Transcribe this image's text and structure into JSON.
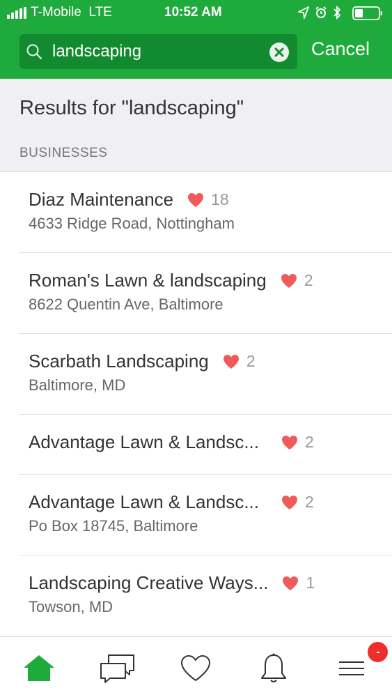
{
  "status_bar": {
    "carrier": "T-Mobile",
    "network": "LTE",
    "time": "10:52 AM"
  },
  "search": {
    "query": "landscaping",
    "cancel_label": "Cancel"
  },
  "results": {
    "title": "Results for \"landscaping\"",
    "section_label": "BUSINESSES",
    "items": [
      {
        "name": "Diaz Maintenance",
        "likes": "18",
        "address": "4633 Ridge Road, Nottingham"
      },
      {
        "name": "Roman's Lawn & landscaping",
        "likes": "2",
        "address": "8622 Quentin Ave, Baltimore"
      },
      {
        "name": "Scarbath Landscaping",
        "likes": "2",
        "address": "Baltimore, MD"
      },
      {
        "name": "Advantage Lawn & Landsc...",
        "likes": "2",
        "address": ""
      },
      {
        "name": "Advantage Lawn & Landsc...",
        "likes": "2",
        "address": "Po Box 18745, Baltimore"
      },
      {
        "name": "Landscaping Creative Ways...",
        "likes": "1",
        "address": "Towson, MD"
      }
    ]
  },
  "bottom_nav": {
    "items": [
      {
        "icon": "home-icon",
        "active": true
      },
      {
        "icon": "chat-icon",
        "active": false
      },
      {
        "icon": "heart-icon",
        "active": false
      },
      {
        "icon": "bell-icon",
        "active": false
      },
      {
        "icon": "menu-icon",
        "active": false,
        "has_badge": true
      }
    ]
  },
  "colors": {
    "brand_green": "#1faa3c",
    "search_field_green": "#128a2f",
    "heart_red": "#f05a5a",
    "badge_red": "#ee2d2d"
  }
}
